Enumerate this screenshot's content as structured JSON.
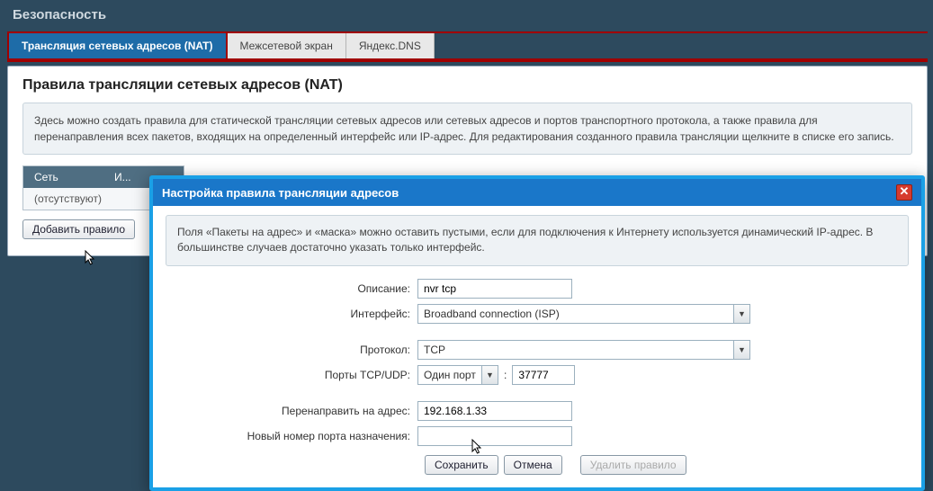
{
  "page_title": "Безопасность",
  "tabs": [
    {
      "label": "Трансляция сетевых адресов (NAT)",
      "active": true
    },
    {
      "label": "Межсетевой экран",
      "active": false
    },
    {
      "label": "Яндекс.DNS",
      "active": false
    }
  ],
  "section": {
    "heading": "Правила трансляции сетевых адресов (NAT)",
    "info": "Здесь можно создать правила для статической трансляции сетевых адресов или сетевых адресов и портов транспортного протокола, а также правила для перенаправления всех пакетов, входящих на определенный интерфейс или IP-адрес. Для редактирования созданного правила трансляции щелкните в списке его запись.",
    "table": {
      "headers": [
        "Сеть",
        "И..."
      ],
      "rows": [
        [
          "(отсутствуют)"
        ]
      ]
    },
    "add_button": "Добавить правило"
  },
  "modal": {
    "title": "Настройка правила трансляции адресов",
    "info": "Поля «Пакеты на адрес» и «маска» можно оставить пустыми, если для подключения к Интернету используется динамический IP-адрес. В большинстве случаев достаточно указать только интерфейс.",
    "fields": {
      "description_label": "Описание:",
      "description_value": "nvr tcp",
      "interface_label": "Интерфейс:",
      "interface_value": "Broadband connection (ISP)",
      "protocol_label": "Протокол:",
      "protocol_value": "TCP",
      "ports_label": "Порты TCP/UDP:",
      "ports_mode": "Один порт",
      "ports_sep": ":",
      "ports_value": "37777",
      "redirect_label": "Перенаправить на адрес:",
      "redirect_value": "192.168.1.33",
      "newport_label": "Новый номер порта назначения:",
      "newport_value": ""
    },
    "actions": {
      "save": "Сохранить",
      "cancel": "Отмена",
      "delete": "Удалить правило"
    }
  }
}
